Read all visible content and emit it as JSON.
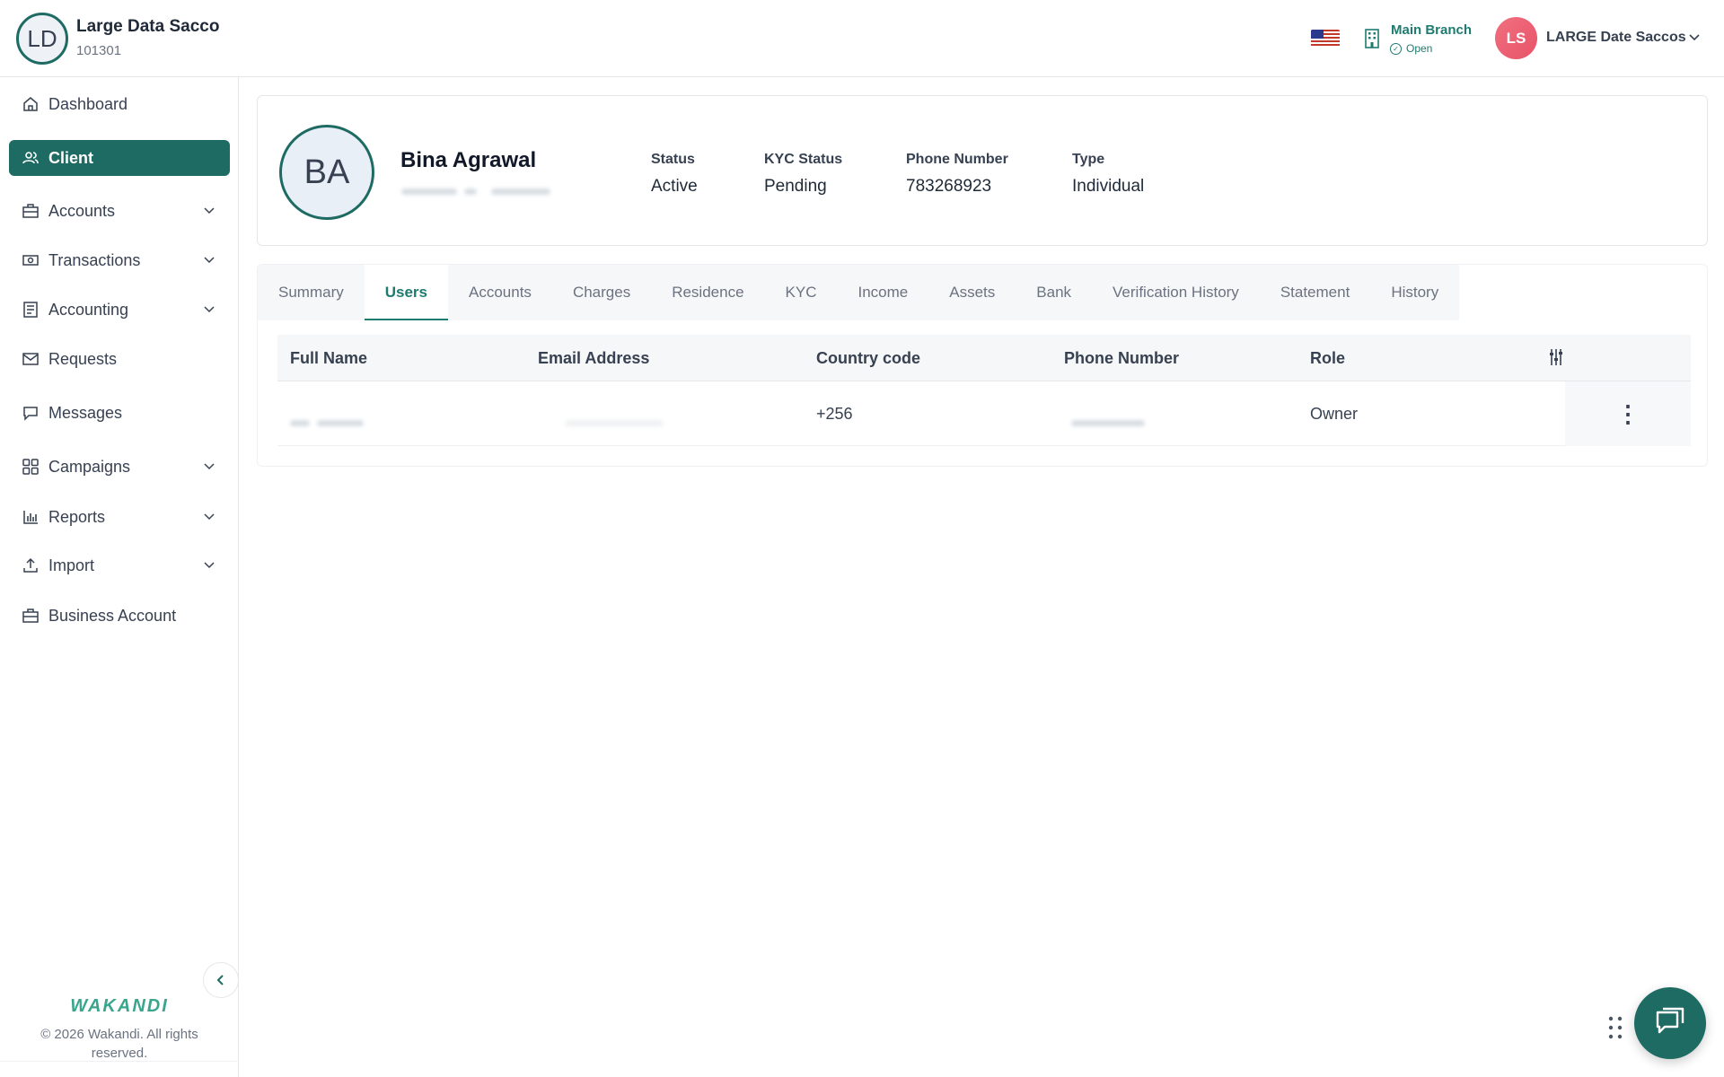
{
  "header": {
    "org_initials": "LD",
    "org_name": "Large Data Sacco",
    "org_id": "101301",
    "branch_name": "Main Branch",
    "branch_status": "Open",
    "user_initials": "LS",
    "user_name": "LARGE Date Saccos"
  },
  "sidebar": {
    "items": [
      {
        "label": "Dashboard",
        "icon": "home-icon"
      },
      {
        "label": "Client",
        "icon": "users-icon"
      },
      {
        "label": "Accounts",
        "icon": "briefcase-icon"
      },
      {
        "label": "Transactions",
        "icon": "money-icon"
      },
      {
        "label": "Accounting",
        "icon": "ledger-icon"
      },
      {
        "label": "Requests",
        "icon": "mail-icon"
      },
      {
        "label": "Messages",
        "icon": "chat-icon"
      },
      {
        "label": "Campaigns",
        "icon": "grid-icon"
      },
      {
        "label": "Reports",
        "icon": "bar-chart-icon"
      },
      {
        "label": "Import",
        "icon": "upload-icon"
      },
      {
        "label": "Business Account",
        "icon": "briefcase-icon"
      }
    ],
    "brand": "WAKANDI",
    "copyright": "© 2026 Wakandi. All rights reserved."
  },
  "profile": {
    "initials": "BA",
    "name": "Bina Agrawal",
    "status_label": "Status",
    "status_value": "Active",
    "kyc_label": "KYC Status",
    "kyc_value": "Pending",
    "phone_label": "Phone Number",
    "phone_value": "783268923",
    "type_label": "Type",
    "type_value": "Individual"
  },
  "tabs": [
    "Summary",
    "Users",
    "Accounts",
    "Charges",
    "Residence",
    "KYC",
    "Income",
    "Assets",
    "Bank",
    "Verification History",
    "Statement",
    "History"
  ],
  "active_tab": "Users",
  "table": {
    "columns": [
      "Full Name",
      "Email Address",
      "Country code",
      "Phone Number",
      "Role"
    ],
    "rows": [
      {
        "country_code": "+256",
        "role": "Owner"
      }
    ]
  },
  "colors": {
    "primary": "#1e6b63",
    "accent": "#1e7b70",
    "user_avatar": "#e85368"
  }
}
